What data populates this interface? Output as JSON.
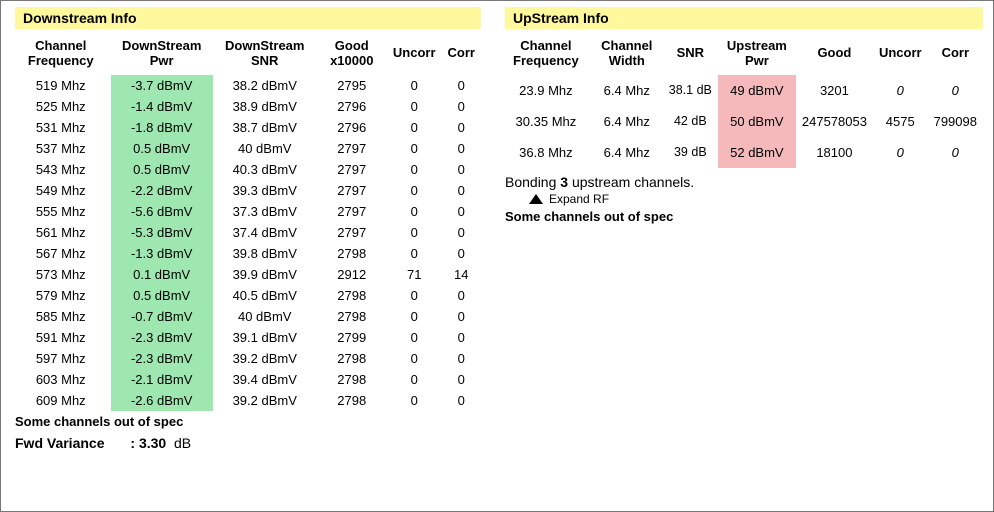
{
  "downstream": {
    "title": "Downstream Info",
    "headers": [
      "Channel Frequency",
      "DownStream Pwr",
      "DownStream SNR",
      "Good x10000",
      "Uncorr",
      "Corr"
    ],
    "rows": [
      {
        "freq": "519 Mhz",
        "pwr": "-3.7 dBmV",
        "snr": "38.2 dBmV",
        "good": "2795",
        "uncorr": "0",
        "corr": "0"
      },
      {
        "freq": "525 Mhz",
        "pwr": "-1.4 dBmV",
        "snr": "38.9 dBmV",
        "good": "2796",
        "uncorr": "0",
        "corr": "0"
      },
      {
        "freq": "531 Mhz",
        "pwr": "-1.8 dBmV",
        "snr": "38.7 dBmV",
        "good": "2796",
        "uncorr": "0",
        "corr": "0"
      },
      {
        "freq": "537 Mhz",
        "pwr": "0.5 dBmV",
        "snr": "40 dBmV",
        "good": "2797",
        "uncorr": "0",
        "corr": "0"
      },
      {
        "freq": "543 Mhz",
        "pwr": "0.5 dBmV",
        "snr": "40.3 dBmV",
        "good": "2797",
        "uncorr": "0",
        "corr": "0"
      },
      {
        "freq": "549 Mhz",
        "pwr": "-2.2 dBmV",
        "snr": "39.3 dBmV",
        "good": "2797",
        "uncorr": "0",
        "corr": "0"
      },
      {
        "freq": "555 Mhz",
        "pwr": "-5.6 dBmV",
        "snr": "37.3 dBmV",
        "good": "2797",
        "uncorr": "0",
        "corr": "0"
      },
      {
        "freq": "561 Mhz",
        "pwr": "-5.3 dBmV",
        "snr": "37.4 dBmV",
        "good": "2797",
        "uncorr": "0",
        "corr": "0"
      },
      {
        "freq": "567 Mhz",
        "pwr": "-1.3 dBmV",
        "snr": "39.8 dBmV",
        "good": "2798",
        "uncorr": "0",
        "corr": "0"
      },
      {
        "freq": "573 Mhz",
        "pwr": "0.1 dBmV",
        "snr": "39.9 dBmV",
        "good": "2912",
        "uncorr": "71",
        "corr": "14"
      },
      {
        "freq": "579 Mhz",
        "pwr": "0.5 dBmV",
        "snr": "40.5 dBmV",
        "good": "2798",
        "uncorr": "0",
        "corr": "0"
      },
      {
        "freq": "585 Mhz",
        "pwr": "-0.7 dBmV",
        "snr": "40 dBmV",
        "good": "2798",
        "uncorr": "0",
        "corr": "0"
      },
      {
        "freq": "591 Mhz",
        "pwr": "-2.3 dBmV",
        "snr": "39.1 dBmV",
        "good": "2799",
        "uncorr": "0",
        "corr": "0"
      },
      {
        "freq": "597 Mhz",
        "pwr": "-2.3 dBmV",
        "snr": "39.2 dBmV",
        "good": "2798",
        "uncorr": "0",
        "corr": "0"
      },
      {
        "freq": "603 Mhz",
        "pwr": "-2.1 dBmV",
        "snr": "39.4 dBmV",
        "good": "2798",
        "uncorr": "0",
        "corr": "0"
      },
      {
        "freq": "609 Mhz",
        "pwr": "-2.6 dBmV",
        "snr": "39.2 dBmV",
        "good": "2798",
        "uncorr": "0",
        "corr": "0"
      }
    ],
    "warning": "Some channels out of spec",
    "fwd_label": "Fwd Variance",
    "fwd_value_prefix": ": ",
    "fwd_value": "3.30",
    "fwd_unit": "dB"
  },
  "upstream": {
    "title": "UpStream Info",
    "headers": [
      "Channel Frequency",
      "Channel Width",
      "SNR",
      "Upstream Pwr",
      "Good",
      "Uncorr",
      "Corr"
    ],
    "rows": [
      {
        "freq": "23.9 Mhz",
        "width": "6.4 Mhz",
        "snr": "38.1 dB",
        "pwr": "49 dBmV",
        "good": "3201",
        "uncorr": "0",
        "corr": "0",
        "italic": true
      },
      {
        "freq": "30.35 Mhz",
        "width": "6.4 Mhz",
        "snr": "42 dB",
        "pwr": "50 dBmV",
        "good": "247578053",
        "uncorr": "4575",
        "corr": "799098",
        "italic": false
      },
      {
        "freq": "36.8 Mhz",
        "width": "6.4 Mhz",
        "snr": "39 dB",
        "pwr": "52 dBmV",
        "good": "18100",
        "uncorr": "0",
        "corr": "0",
        "italic": true
      }
    ],
    "bonding_prefix": "Bonding ",
    "bonding_count": "3",
    "bonding_suffix": " upstream channels.",
    "expand_label": "Expand RF",
    "warning": "Some channels out of spec"
  }
}
